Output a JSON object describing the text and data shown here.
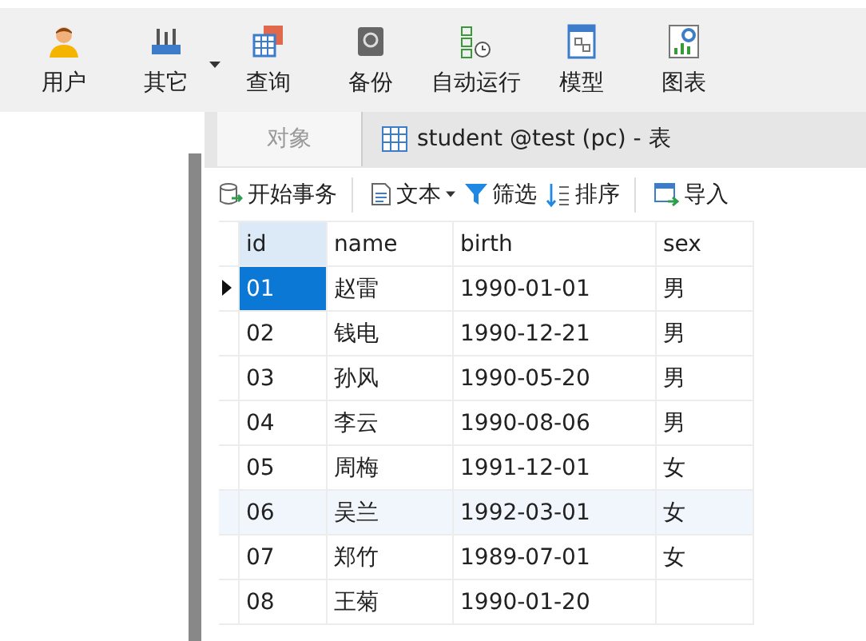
{
  "toolbar": [
    {
      "kind": "user",
      "label": "用户",
      "has_menu": false
    },
    {
      "kind": "others",
      "label": "其它",
      "has_menu": true
    },
    {
      "kind": "query",
      "label": "查询",
      "has_menu": false
    },
    {
      "kind": "backup",
      "label": "备份",
      "has_menu": false
    },
    {
      "kind": "automation",
      "label": "自动运行",
      "has_menu": false
    },
    {
      "kind": "model",
      "label": "模型",
      "has_menu": false
    },
    {
      "kind": "chart",
      "label": "图表",
      "has_menu": false
    }
  ],
  "tabs": [
    {
      "label": "对象",
      "kind": "plain",
      "selected": false
    },
    {
      "label": "student @test (pc) - 表",
      "kind": "table",
      "selected": true
    }
  ],
  "data_toolbar": [
    {
      "kind": "transaction",
      "label": "开始事务",
      "has_menu": false,
      "separator_after": true
    },
    {
      "kind": "text",
      "label": "文本",
      "has_menu": true,
      "separator_after": false
    },
    {
      "kind": "filter",
      "label": "筛选",
      "has_menu": false,
      "separator_after": false
    },
    {
      "kind": "sort",
      "label": "排序",
      "has_menu": false,
      "separator_after": true
    },
    {
      "kind": "import",
      "label": "导入",
      "has_menu": false,
      "separator_after": false
    }
  ],
  "table": {
    "columns": [
      {
        "label": "id",
        "selected": true
      },
      {
        "label": "name",
        "selected": false
      },
      {
        "label": "birth",
        "selected": false
      },
      {
        "label": "sex",
        "selected": false
      }
    ],
    "rows": [
      {
        "cells": [
          "01",
          "赵雷",
          "1990-01-01",
          "男"
        ],
        "selected": true,
        "hovered": false
      },
      {
        "cells": [
          "02",
          "钱电",
          "1990-12-21",
          "男"
        ],
        "selected": false,
        "hovered": false
      },
      {
        "cells": [
          "03",
          "孙风",
          "1990-05-20",
          "男"
        ],
        "selected": false,
        "hovered": false
      },
      {
        "cells": [
          "04",
          "李云",
          "1990-08-06",
          "男"
        ],
        "selected": false,
        "hovered": false
      },
      {
        "cells": [
          "05",
          "周梅",
          "1991-12-01",
          "女"
        ],
        "selected": false,
        "hovered": false
      },
      {
        "cells": [
          "06",
          "吴兰",
          "1992-03-01",
          "女"
        ],
        "selected": false,
        "hovered": true
      },
      {
        "cells": [
          "07",
          "郑竹",
          "1989-07-01",
          "女"
        ],
        "selected": false,
        "hovered": false
      },
      {
        "cells": [
          "08",
          "王菊",
          "1990-01-20"
        ],
        "selected": false,
        "hovered": false
      }
    ]
  }
}
